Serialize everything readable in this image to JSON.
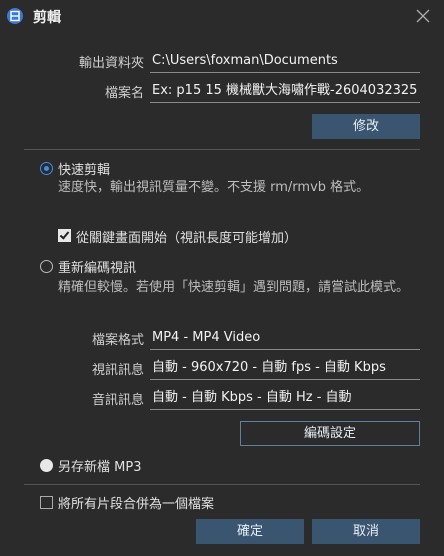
{
  "window": {
    "title": "剪輯"
  },
  "output": {
    "folder_label": "輸出資料夾",
    "folder_value": "C:\\Users\\foxman\\Documents",
    "filename_label": "檔案名",
    "filename_value": "Ex: p15 15 機械獸大海嘯作戰-2604032325",
    "modify_button": "修改"
  },
  "quick_cut": {
    "label": "快速剪輯",
    "selected": true,
    "description": "速度快，輸出視訊質量不變。不支援 rm/rmvb 格式。",
    "keyframe_checkbox_label": "從關鍵畫面開始（視訊長度可能增加）",
    "keyframe_checked": true
  },
  "reencode": {
    "label": "重新編碼視訊",
    "selected": false,
    "description": "精確但較慢。若使用「快速剪輯」遇到問題，請嘗試此模式。",
    "format_label": "檔案格式",
    "format_value": "MP4 - MP4 Video",
    "video_label": "視訊訊息",
    "video_value": "自動 - 960x720 - 自動 fps - 自動 Kbps",
    "audio_label": "音訊訊息",
    "audio_value": "自動 - 自動 Kbps - 自動 Hz - 自動",
    "encode_settings_button": "編碼設定"
  },
  "save_mp3": {
    "label": "另存新檔 MP3",
    "selected": false
  },
  "merge": {
    "label": "將所有片段合併為一個檔案",
    "checked": false
  },
  "footer": {
    "ok_button": "確定",
    "cancel_button": "取消"
  },
  "colors": {
    "accent": "#3e8ee8",
    "button": "#3a5570",
    "background": "#2b2b2b"
  }
}
